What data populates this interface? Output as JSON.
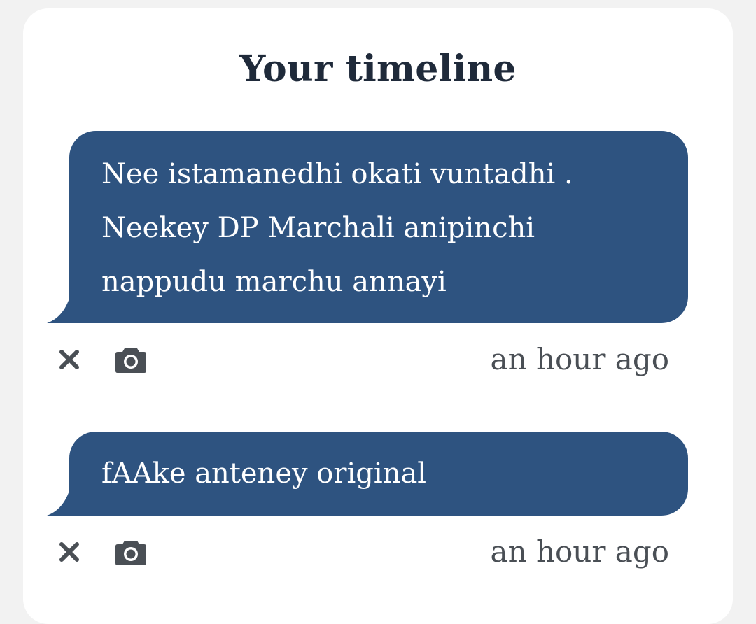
{
  "header": {
    "title": "Your timeline"
  },
  "posts": [
    {
      "text": "Nee istamanedhi okati vuntadhi .\nNeekey DP Marchali anipinchi\nnappudu marchu annayi",
      "time": "an hour ago",
      "delete_icon": "close-icon",
      "photo_icon": "camera-icon"
    },
    {
      "text": "fAAke anteney original",
      "time": "an hour ago",
      "delete_icon": "close-icon",
      "photo_icon": "camera-icon"
    }
  ],
  "colors": {
    "background": "#f2f2f2",
    "card": "#ffffff",
    "bubble": "#2e5380",
    "bubble_text": "#ffffff",
    "title": "#1f2a3a",
    "meta": "#4a4f55"
  }
}
